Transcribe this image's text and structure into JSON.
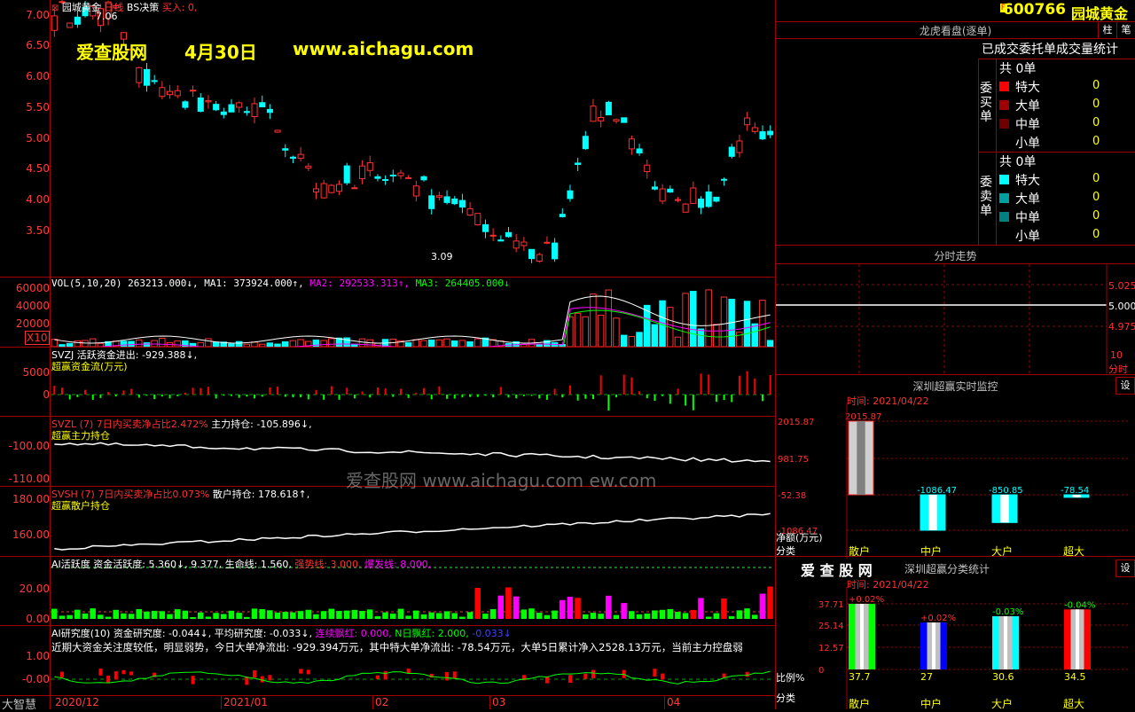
{
  "stock": {
    "code": "600766",
    "name": "园城黄金",
    "badge": "R"
  },
  "main_chart": {
    "name": "园城黄金",
    "period": "日线",
    "indicator": "BS决策",
    "signal": "买入: 0,",
    "high_label": "7.06",
    "low_label": "3.09",
    "y_ticks": [
      "7.00",
      "6.50",
      "6.00",
      "5.50",
      "5.00",
      "4.50",
      "4.00",
      "3.50"
    ]
  },
  "watermark": {
    "site": "爱查股网",
    "date": "4月30日",
    "url": "www.aichagu.com"
  },
  "vol_panel": {
    "header": "VOL(5,10,20) 263213.000↓,",
    "ma1": "MA1: 373924.000↑,",
    "ma2": "MA2: 292533.313↑,",
    "ma3": "MA3: 264405.000↓",
    "y_ticks": [
      "60000",
      "40000",
      "20000"
    ],
    "unit": "X10"
  },
  "svzj_panel": {
    "header": "SVZJ  活跃资金进出: -929.388↓,",
    "sub": "超赢资金流(万元)",
    "y_ticks": [
      "5000",
      "0"
    ]
  },
  "svzl_panel": {
    "header": "SVZL (7) 7日内买卖净占比2.472%",
    "extra": "主力持仓: -105.896↓,",
    "sub": "超赢主力持仓",
    "y_ticks": [
      "-100.00",
      "-110.00"
    ]
  },
  "svsh_panel": {
    "header": "SVSH (7) 7日内买卖净占比0.073%",
    "extra": "散户持仓: 178.618↑,",
    "sub": "超赢散户持仓",
    "y_ticks": [
      "180.00",
      "160.00"
    ]
  },
  "ai_active_panel": {
    "header": "AI活跃度 资金活跃度: 5.360↓, 9.377, 生命线: 1.560,",
    "strong": "强势线: 3.000,",
    "burst": "爆发线: 8.000,",
    "y_ticks": [
      "20.00",
      "0.00"
    ]
  },
  "ai_research_panel": {
    "header": "AI研究度(10) 资金研究度: -0.044↓, 平均研究度: -0.033↓,",
    "lianxu": "连续飘红: 0.000,",
    "nri": "N日飘红: 2.000,",
    "last": "-0.033↓",
    "text": "近期大资金关注度较低，明显弱势，今日大单净流出: -929.394万元，其中特大单净流出: -78.54万元，大单5日累计净入2528.13万元，当前主力控盘弱",
    "y_ticks": [
      "1.00",
      "-0.00"
    ]
  },
  "x_axis": {
    "labels": [
      "2020/12",
      "2021/01",
      "02",
      "03",
      "04"
    ],
    "footer": "大智慧"
  },
  "center_watermark": "爱查股网     www.aichagu.com    ew.com",
  "right": {
    "lhkp": {
      "title": "龙虎看盘(逐单)",
      "btn1": "柱",
      "btn2": "笔",
      "subtitle": "已成交委托单成交量统计",
      "buy_label": "委买单",
      "sell_label": "委卖单",
      "buy_total": "共 0单",
      "sell_total": "共 0单",
      "rows": [
        {
          "label": "特大",
          "value": "0"
        },
        {
          "label": "大单",
          "value": "0"
        },
        {
          "label": "中单",
          "value": "0"
        },
        {
          "label": "小单",
          "value": "0"
        }
      ],
      "buy_colors": [
        "#ff0000",
        "#a00000",
        "#700000",
        "#000000"
      ],
      "sell_colors": [
        "#00ffff",
        "#00a0a0",
        "#008080",
        "#000000"
      ]
    },
    "fenshi": {
      "title": "分时走势",
      "y_ticks": [
        "5.025",
        "5.000",
        "4.975"
      ],
      "x_label": "10",
      "x_label2": "分时"
    },
    "rt_monitor": {
      "title": "深圳超赢实时监控",
      "btn": "设",
      "time": "时间: 2021/04/22",
      "y_ticks": [
        "2015.87",
        "981.75",
        "-52.38",
        "-1086.47"
      ],
      "ylabel": "净额(万元)",
      "xlabel": "分类",
      "categories": [
        "散户",
        "中户",
        "大户",
        "超大"
      ],
      "values": [
        2015.87,
        -1086.47,
        -850.85,
        -78.54
      ],
      "value_labels": [
        "2015.87",
        "-1086.47",
        "-850.85",
        "-78.54"
      ]
    },
    "classify": {
      "brand": "爱 查 股 网",
      "title": "深圳超赢分类统计",
      "btn": "设",
      "time": "时间: 2021/04/22",
      "y_ticks": [
        "37.71",
        "25.14",
        "12.57",
        "0"
      ],
      "ylabel": "比例%",
      "xlabel": "分类",
      "categories": [
        "散户",
        "中户",
        "大户",
        "超大"
      ],
      "values": [
        37.7,
        27.0,
        30.6,
        34.5
      ],
      "changes": [
        "+0.02%",
        "+0.02%",
        "-0.03%",
        "-0.04%"
      ],
      "colors": [
        "#00ff00",
        "#0000ff",
        "#00ffff",
        "#ff0000"
      ]
    }
  }
}
